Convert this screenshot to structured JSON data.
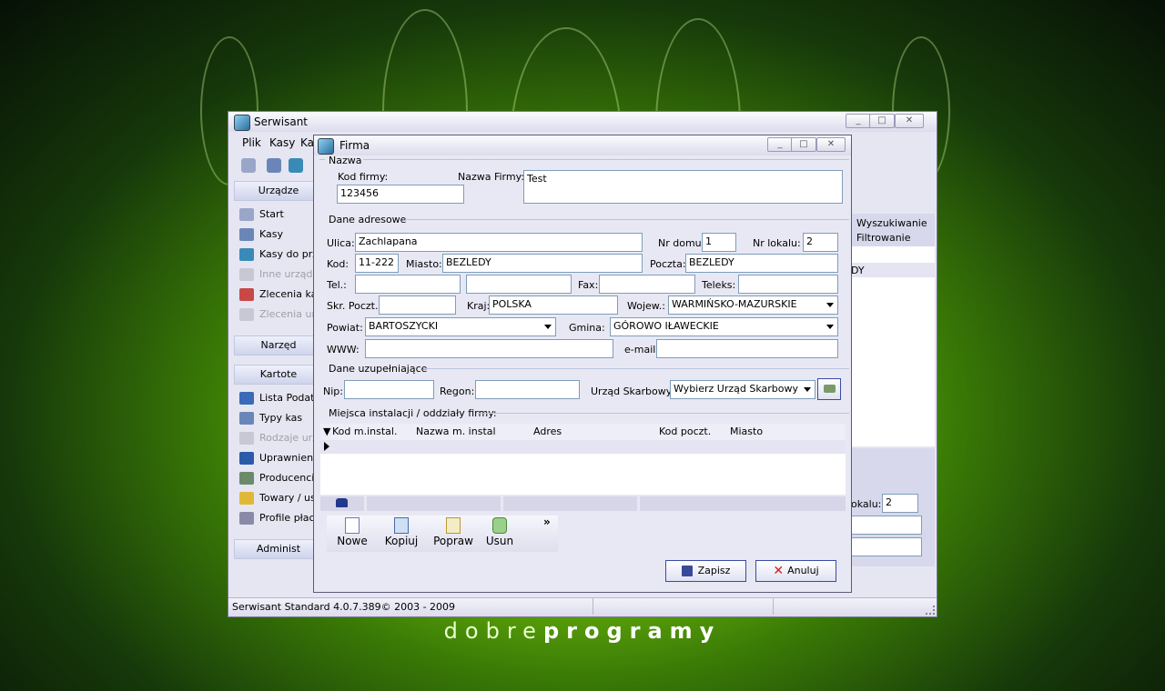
{
  "brand": {
    "light": "dobre",
    "bold": "programy"
  },
  "main_window": {
    "title": "Serwisant",
    "menu": [
      "Plik",
      "Kasy",
      "Ka"
    ],
    "sidebar": {
      "group1_header": "Urządze",
      "items1": [
        {
          "label": "Start",
          "enabled": true
        },
        {
          "label": "Kasy",
          "enabled": true
        },
        {
          "label": "Kasy do prz",
          "enabled": true
        },
        {
          "label": "Inne urządz",
          "enabled": false
        },
        {
          "label": "Zlecenia ka",
          "enabled": true
        },
        {
          "label": "Zlecenia ur",
          "enabled": false
        }
      ],
      "group2_header": "Narzęd",
      "group3_header": "Kartote",
      "items3": [
        {
          "label": "Lista Podatn",
          "enabled": true
        },
        {
          "label": "Typy kas",
          "enabled": true
        },
        {
          "label": "Rodzaje urz",
          "enabled": false
        },
        {
          "label": "Uprawnienia",
          "enabled": true
        },
        {
          "label": "Producenci",
          "enabled": true
        },
        {
          "label": "Towary / us",
          "enabled": true
        },
        {
          "label": "Profile płac",
          "enabled": true
        }
      ],
      "group4_header": "Administ"
    },
    "right_panel": {
      "search_label": "Wyszukiwanie",
      "filter_label": "Filtrowanie",
      "row_text": "DY",
      "nr_lokalu_label": "okalu:",
      "nr_lokalu_value": "2"
    },
    "status_bar": "Serwisant Standard 4.0.7.389© 2003 - 2009"
  },
  "dialog": {
    "title": "Firma",
    "nazwa_group": "Nazwa",
    "kod_firmy_label": "Kod firmy:",
    "kod_firmy_value": "123456",
    "nazwa_firmy_label": "Nazwa Firmy:",
    "nazwa_firmy_value": "Test",
    "adres_group": "Dane adresowe",
    "ulica_label": "Ulica:",
    "ulica_value": "Zachlapana",
    "nr_domu_label": "Nr domu:",
    "nr_domu_value": "1",
    "nr_lokalu_label": "Nr lokalu:",
    "nr_lokalu_value": "2",
    "kod_label": "Kod:",
    "kod_value": "11-222",
    "miasto_label": "Miasto:",
    "miasto_value": "BEZLEDY",
    "poczta_label": "Poczta:",
    "poczta_value": "BEZLEDY",
    "tel_label": "Tel.:",
    "tel_value": "",
    "fax_label": "Fax:",
    "fax_value": "",
    "teleks_label": "Teleks:",
    "teleks_value": "",
    "skr_label": "Skr. Poczt.:",
    "skr_value": "",
    "kraj_label": "Kraj:",
    "kraj_value": "POLSKA",
    "woj_label": "Wojew.:",
    "woj_value": "WARMIŃSKO-MAZURSKIE",
    "powiat_label": "Powiat:",
    "powiat_value": "BARTOSZYCKI",
    "gmina_label": "Gmina:",
    "gmina_value": "GÓROWO IŁAWECKIE",
    "www_label": "WWW:",
    "www_value": "",
    "email_label": "e-mail:",
    "email_value": "",
    "uzup_group": "Dane uzupełniające",
    "nip_label": "Nip:",
    "nip_value": "",
    "regon_label": "Regon:",
    "regon_value": "",
    "us_label": "Urząd Skarbowy:",
    "us_value": "Wybierz Urząd Skarbowy",
    "miejsca_group": "Miejsca instalacji / oddziały firmy:",
    "grid_headers": [
      "Kod m.instal.",
      "Nazwa m. instal",
      "Adres",
      "Kod poczt.",
      "Miasto"
    ],
    "toolbar": {
      "nowe": "Nowe",
      "kopiuj": "Kopiuj",
      "popraw": "Popraw",
      "usun": "Usun",
      "more": "»"
    },
    "zapisz": "Zapisz",
    "anuluj": "Anuluj"
  },
  "colors": {
    "accent_border": "#3b4aa6",
    "window_bg": "#e6e6f2",
    "cancel_x": "#d02020"
  }
}
